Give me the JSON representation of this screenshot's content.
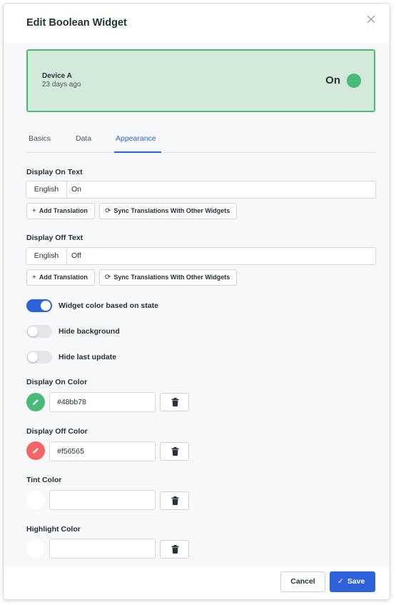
{
  "dialog": {
    "title": "Edit Boolean Widget"
  },
  "preview": {
    "device_name": "Device A",
    "updated": "23 days ago",
    "state_text": "On",
    "state_color": "#48bb78",
    "background_color": "#d3eadb"
  },
  "tabs": [
    {
      "label": "Basics",
      "active": false
    },
    {
      "label": "Data",
      "active": false
    },
    {
      "label": "Appearance",
      "active": true
    }
  ],
  "on_text": {
    "label": "Display On Text",
    "language": "English",
    "value": "On",
    "add_translation": "Add Translation",
    "sync_translations": "Sync Translations With Other Widgets"
  },
  "off_text": {
    "label": "Display Off Text",
    "language": "English",
    "value": "Off",
    "add_translation": "Add Translation",
    "sync_translations": "Sync Translations With Other Widgets"
  },
  "toggles": [
    {
      "label": "Widget color based on state",
      "on": true
    },
    {
      "label": "Hide background",
      "on": false
    },
    {
      "label": "Hide last update",
      "on": false
    }
  ],
  "colors": {
    "on": {
      "label": "Display On Color",
      "value": "#48bb78"
    },
    "off": {
      "label": "Display Off Color",
      "value": "#f56565"
    },
    "tint": {
      "label": "Tint Color",
      "value": ""
    },
    "highlight": {
      "label": "Highlight Color",
      "value": ""
    }
  },
  "footer": {
    "cancel_label": "Cancel",
    "save_label": "Save"
  },
  "icons": {
    "close": "close-icon",
    "plus": "plus-icon",
    "sync": "sync-icon",
    "pencil": "pencil-icon",
    "trash": "trash-icon",
    "check": "check-icon"
  },
  "theme": {
    "accent": "#2e62db"
  }
}
